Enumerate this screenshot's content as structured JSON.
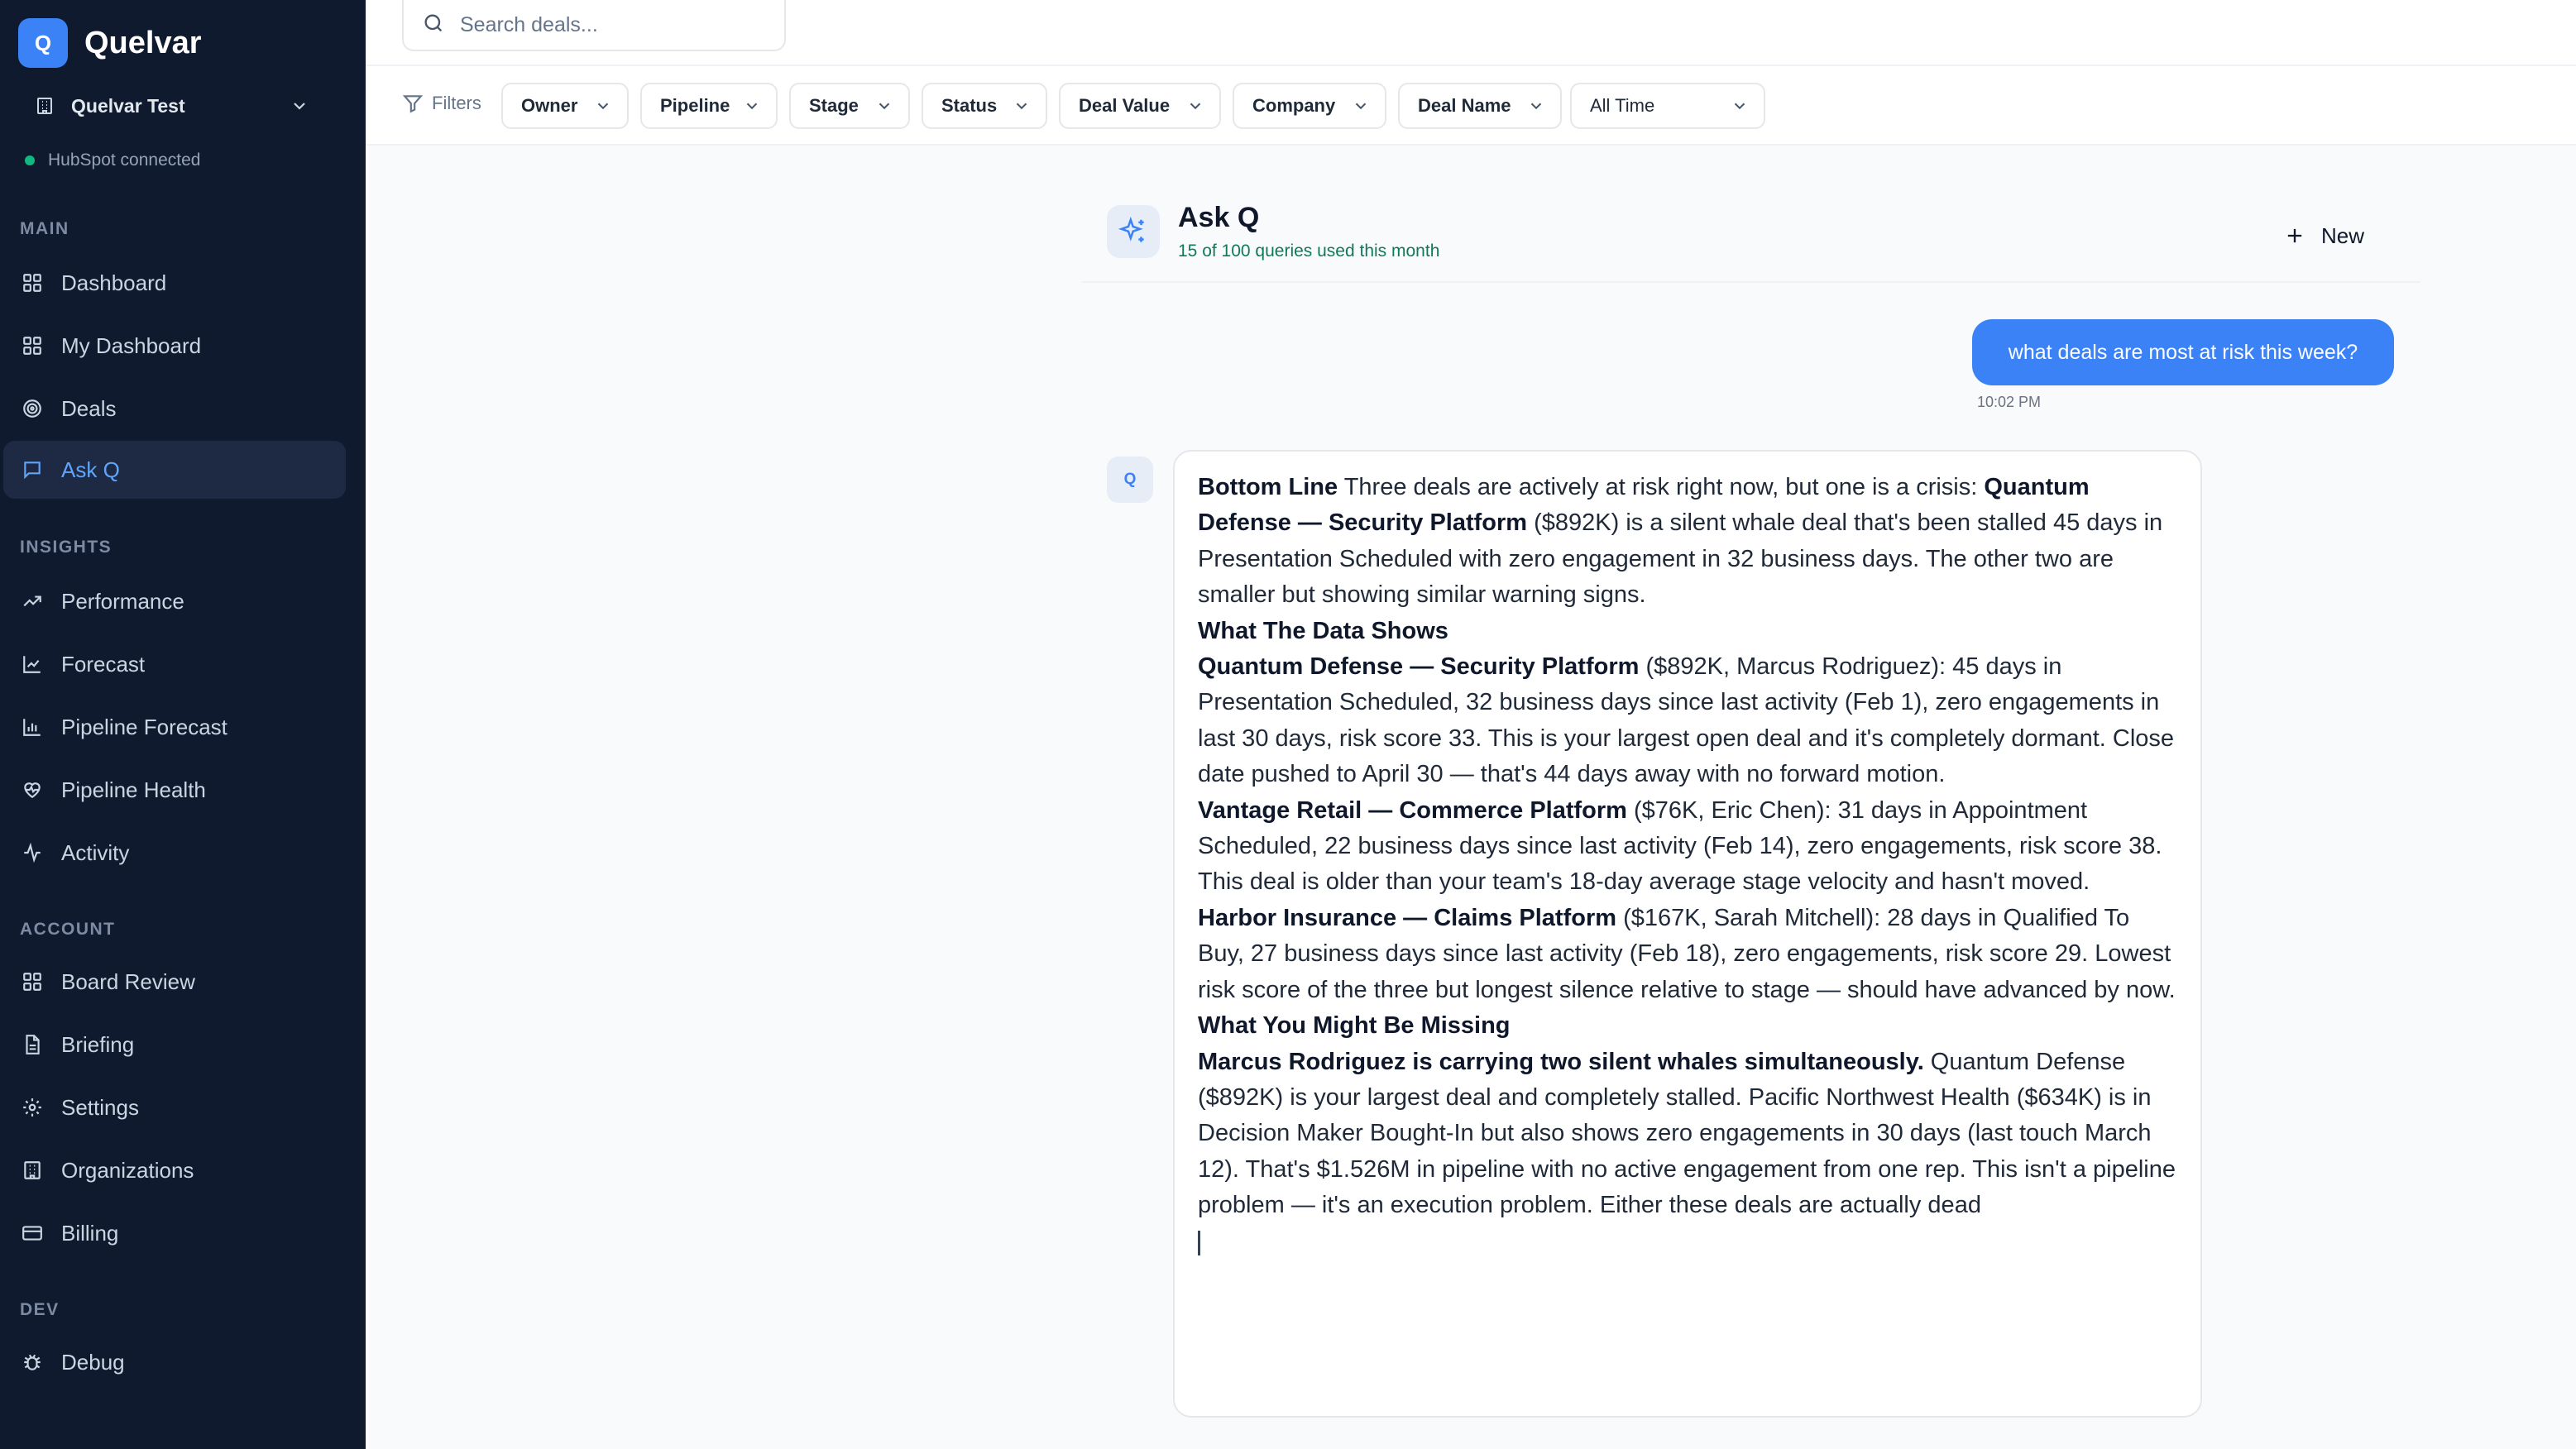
{
  "sidebar": {
    "brand_initial": "Q",
    "brand_name": "Quelvar",
    "org_name": "Quelvar Test",
    "connection_status": "HubSpot connected",
    "sections": {
      "main": "MAIN",
      "insights": "INSIGHTS",
      "account": "ACCOUNT",
      "dev": "DEV"
    },
    "items": {
      "dashboard": "Dashboard",
      "my_dashboard": "My Dashboard",
      "deals": "Deals",
      "ask_q": "Ask Q",
      "performance": "Performance",
      "forecast": "Forecast",
      "pipeline_forecast": "Pipeline Forecast",
      "pipeline_health": "Pipeline Health",
      "activity": "Activity",
      "board_review": "Board Review",
      "briefing": "Briefing",
      "settings": "Settings",
      "organizations": "Organizations",
      "billing": "Billing",
      "debug": "Debug"
    }
  },
  "search": {
    "placeholder": "Search deals..."
  },
  "filters": {
    "label": "Filters",
    "owner": "Owner",
    "pipeline": "Pipeline",
    "stage": "Stage",
    "status": "Status",
    "deal_value": "Deal Value",
    "company": "Company",
    "deal_name": "Deal Name",
    "time_range": "All Time"
  },
  "ask": {
    "title": "Ask Q",
    "usage": "15 of 100 queries used this month",
    "new_label": "New",
    "bot_initial": "Q"
  },
  "conversation": {
    "user_message": "what deals are most at risk this week?",
    "user_time": "10:02 PM",
    "reply": {
      "h_bottom_line": "Bottom Line",
      "bottom_line_a": " Three deals are actively at risk right now, but one is a crisis: ",
      "bottom_line_deal": "Quantum Defense — Security Platform",
      "bottom_line_b": " ($892K) is a silent whale deal that's been stalled 45 days in Presentation Scheduled with zero engagement in 32 business days. The other two are smaller but showing similar warning signs.",
      "h_data": "What The Data Shows",
      "d1_name": "Quantum Defense — Security Platform",
      "d1_text": " ($892K, Marcus Rodriguez): 45 days in Presentation Scheduled, 32 business days since last activity (Feb 1), zero engagements in last 30 days, risk score 33. This is your largest open deal and it's completely dormant. Close date pushed to April 30 — that's 44 days away with no forward motion.",
      "d2_name": "Vantage Retail — Commerce Platform",
      "d2_text": " ($76K, Eric Chen): 31 days in Appointment Scheduled, 22 business days since last activity (Feb 14), zero engagements, risk score 38. This deal is older than your team's 18-day average stage velocity and hasn't moved.",
      "d3_name": "Harbor Insurance — Claims Platform",
      "d3_text": " ($167K, Sarah Mitchell): 28 days in Qualified To Buy, 27 business days since last activity (Feb 18), zero engagements, risk score 29. Lowest risk score of the three but longest silence relative to stage — should have advanced by now.",
      "h_missing": "What You Might Be Missing",
      "missing_bold": "Marcus Rodriguez is carrying two silent whales simultaneously.",
      "missing_text": " Quantum Defense ($892K) is your largest deal and completely stalled. Pacific Northwest Health ($634K) is in Decision Maker Bought-In but also shows zero engagements in 30 days (last touch March 12). That's $1.526M in pipeline with no active engagement from one rep. This isn't a pipeline problem — it's an execution problem. Either these deals are actually dead"
    }
  },
  "colors": {
    "sidebar_bg": "#0f1a2e",
    "accent": "#3b82f6",
    "success": "#10b981",
    "usage_text": "#0f7a5a"
  }
}
